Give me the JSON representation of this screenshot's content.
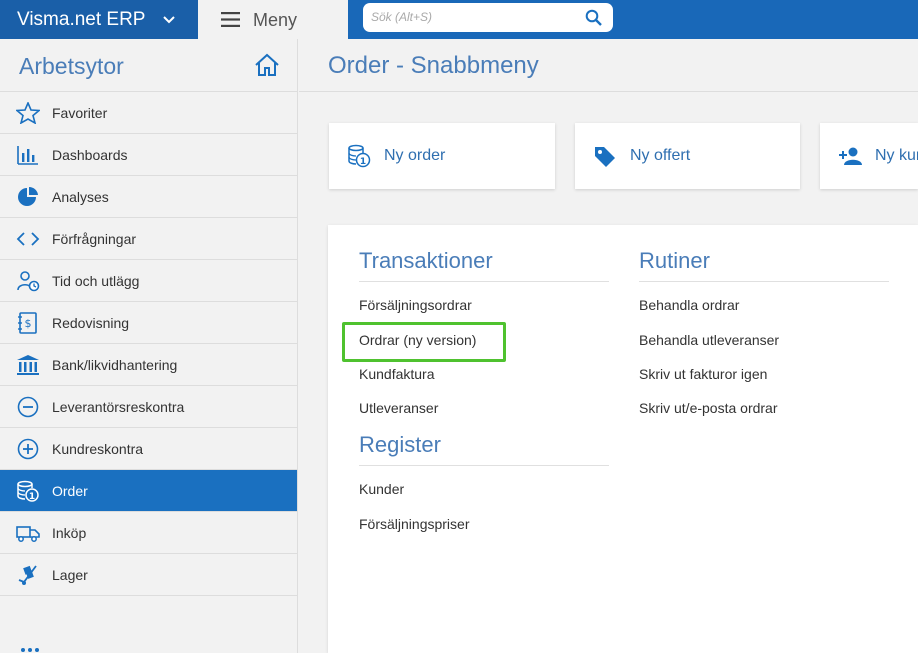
{
  "topbar": {
    "brand": "Visma.net ERP",
    "menu_label": "Meny",
    "search_placeholder": "Sök (Alt+S)"
  },
  "sidebar": {
    "title": "Arbetsytor",
    "items": [
      {
        "label": "Favoriter",
        "icon": "star-icon"
      },
      {
        "label": "Dashboards",
        "icon": "bar-chart-icon"
      },
      {
        "label": "Analyses",
        "icon": "pie-chart-icon"
      },
      {
        "label": "Förfrågningar",
        "icon": "code-brackets-icon"
      },
      {
        "label": "Tid och utlägg",
        "icon": "person-clock-icon"
      },
      {
        "label": "Redovisning",
        "icon": "ledger-icon"
      },
      {
        "label": "Bank/likvidhantering",
        "icon": "bank-icon"
      },
      {
        "label": "Leverantörsreskontra",
        "icon": "minus-circle-icon"
      },
      {
        "label": "Kundreskontra",
        "icon": "plus-circle-icon"
      },
      {
        "label": "Order",
        "icon": "coins-icon",
        "active": true
      },
      {
        "label": "Inköp",
        "icon": "truck-icon"
      },
      {
        "label": "Lager",
        "icon": "hand-truck-icon"
      }
    ]
  },
  "main": {
    "title": "Order - Snabbmeny",
    "quick_actions": [
      {
        "label": "Ny order",
        "icon": "coins-icon"
      },
      {
        "label": "Ny offert",
        "icon": "tag-icon"
      },
      {
        "label": "Ny kund",
        "icon": "add-person-icon"
      }
    ],
    "sections": {
      "transaktioner": {
        "title": "Transaktioner",
        "links": [
          "Försäljningsordrar",
          "Ordrar (ny version)",
          "Kundfaktura",
          "Utleveranser"
        ]
      },
      "register": {
        "title": "Register",
        "links": [
          "Kunder",
          "Försäljningspriser"
        ]
      },
      "rutiner": {
        "title": "Rutiner",
        "links": [
          "Behandla ordrar",
          "Behandla utleveranser",
          "Skriv ut fakturor igen",
          "Skriv ut/e-posta ordrar"
        ]
      }
    }
  },
  "colors": {
    "topbar": "#1968b8",
    "accent": "#1a70c0",
    "title": "#4a7db8",
    "highlight": "#4fc22f"
  }
}
